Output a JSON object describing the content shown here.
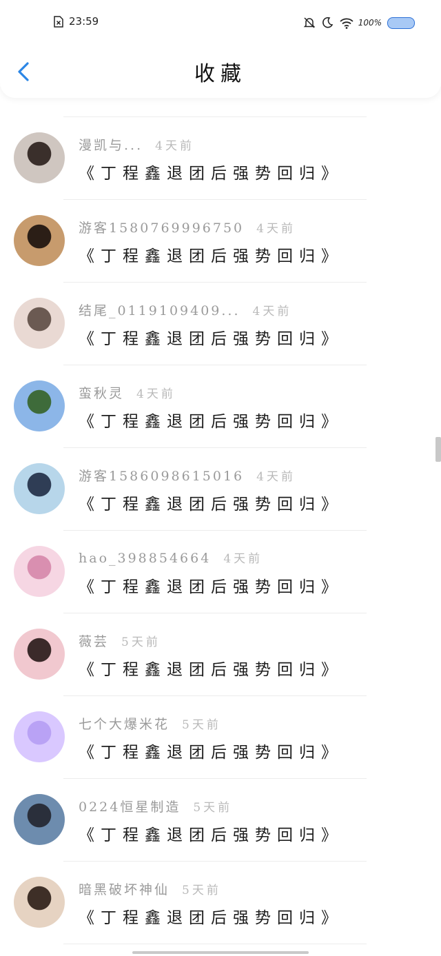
{
  "status_bar": {
    "time": "23:59",
    "battery_text": "100%",
    "icons": [
      "sim-error-icon",
      "bell-off-icon",
      "moon-icon",
      "wifi-icon",
      "battery-icon"
    ],
    "battery_color": "#a8c9f5"
  },
  "nav": {
    "title": "收藏",
    "back_icon": "chevron-left-icon",
    "accent_color": "#2b86e6"
  },
  "items": [
    {
      "username": "漫凯与...",
      "time": "4天前",
      "message": "《丁程鑫退团后强势回归》",
      "avatar_colors": [
        "#cfc6c0",
        "#3a2f2b"
      ]
    },
    {
      "username": "游客1580769996750",
      "time": "4天前",
      "message": "《丁程鑫退团后强势回归》",
      "avatar_colors": [
        "#c79b6d",
        "#2b1e16"
      ]
    },
    {
      "username": "结尾_0119109409...",
      "time": "4天前",
      "message": "《丁程鑫退团后强势回归》",
      "avatar_colors": [
        "#e9d9d3",
        "#6b5a52"
      ]
    },
    {
      "username": "蛮秋灵",
      "time": "4天前",
      "message": "《丁程鑫退团后强势回归》",
      "avatar_colors": [
        "#8cb6e8",
        "#3e6b3a"
      ]
    },
    {
      "username": "游客1586098615016",
      "time": "4天前",
      "message": "《丁程鑫退团后强势回归》",
      "avatar_colors": [
        "#b7d6ea",
        "#2f3d55"
      ]
    },
    {
      "username": "hao_398854664",
      "time": "4天前",
      "message": "《丁程鑫退团后强势回归》",
      "avatar_colors": [
        "#f6d6e3",
        "#d98fb0"
      ]
    },
    {
      "username": "薇芸",
      "time": "5天前",
      "message": "《丁程鑫退团后强势回归》",
      "avatar_colors": [
        "#f1c8cf",
        "#3b2a2a"
      ]
    },
    {
      "username": "七个大爆米花",
      "time": "5天前",
      "message": "《丁程鑫退团后强势回归》",
      "avatar_colors": [
        "#d9c8ff",
        "#b9a2f5"
      ]
    },
    {
      "username": "0224恒星制造",
      "time": "5天前",
      "message": "《丁程鑫退团后强势回归》",
      "avatar_colors": [
        "#6d8cae",
        "#2a2f3b"
      ]
    },
    {
      "username": "暗黑破坏神仙",
      "time": "5天前",
      "message": "《丁程鑫退团后强势回归》",
      "avatar_colors": [
        "#e6d3c2",
        "#3e2f27"
      ]
    }
  ]
}
